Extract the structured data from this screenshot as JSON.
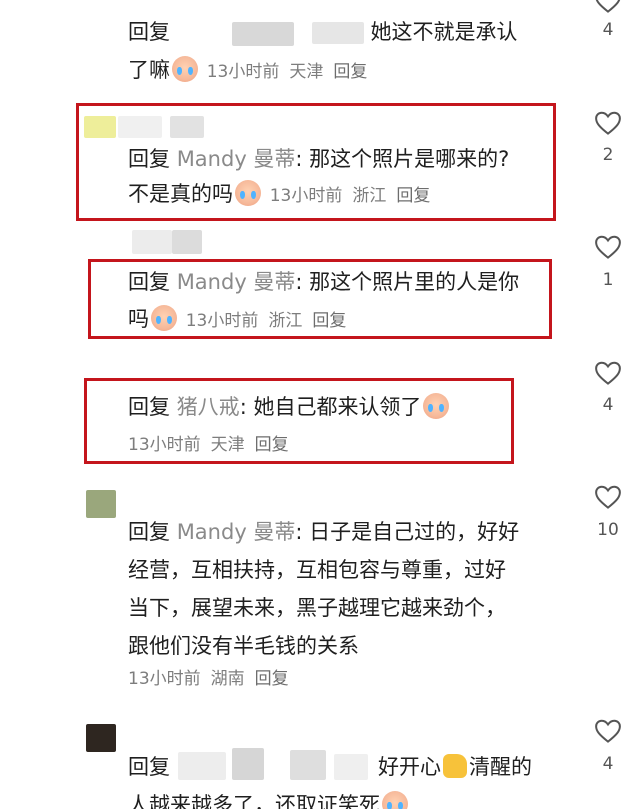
{
  "comments": [
    {
      "reply_word": "回复",
      "username": "",
      "text_line1": ": 她这不就是承认",
      "text_line2": "了嘛",
      "time": "13小时前",
      "location": "天津",
      "reply_link": "回复",
      "likes": "4"
    },
    {
      "reply_word": "回复",
      "username": "Mandy 曼蒂",
      "text_line1": ": 那这个照片是哪来的?",
      "text_line2": "不是真的吗",
      "time": "13小时前",
      "location": "浙江",
      "reply_link": "回复",
      "likes": "2"
    },
    {
      "reply_word": "回复",
      "username": "Mandy 曼蒂",
      "text_line1": ": 那这个照片里的人是你",
      "text_line2": "吗",
      "time": "13小时前",
      "location": "浙江",
      "reply_link": "回复",
      "likes": "1"
    },
    {
      "reply_word": "回复",
      "username": "猪八戒",
      "text_line1": ": 她自己都来认领了",
      "time": "13小时前",
      "location": "天津",
      "reply_link": "回复",
      "likes": "4"
    },
    {
      "reply_word": "回复",
      "username": "Mandy 曼蒂",
      "text_line1": ": 日子是自己过的，好好",
      "text_line2": "经营，互相扶持，互相包容与尊重，过好",
      "text_line3": "当下，展望未来，黑子越理它越来劲个，",
      "text_line4": "跟他们没有半毛钱的关系",
      "time": "13小时前",
      "location": "湖南",
      "reply_link": "回复",
      "likes": "10"
    },
    {
      "reply_word": "回复",
      "text_line1_a": "好开心",
      "text_line1_b": "清醒的",
      "text_line2": "人越来越多了，还取证笑死",
      "likes": "4"
    }
  ],
  "colors": {
    "highlight_box": "#c4151c",
    "heart_stroke": "#555555",
    "username_gray": "#8a8a8a"
  },
  "icons": [
    "heart-icon",
    "crying-face-emoji",
    "thumbs-up-emoji"
  ]
}
